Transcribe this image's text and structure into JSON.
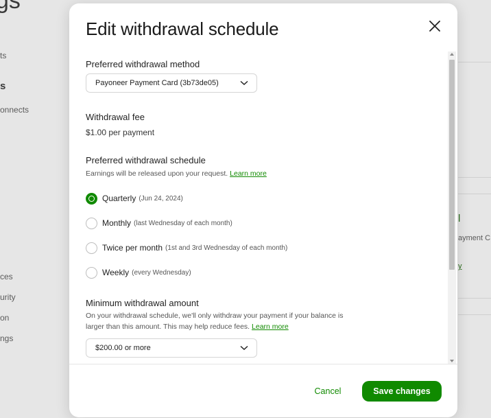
{
  "background": {
    "heading": "gs",
    "sidebar": [
      "ts",
      "s",
      "onnects",
      "ces",
      "urity",
      "on",
      "ngs"
    ],
    "right": [
      "l",
      "ayment C",
      "y"
    ]
  },
  "modal": {
    "title": "Edit withdrawal schedule",
    "method": {
      "label": "Preferred withdrawal method",
      "selected": "Payoneer Payment Card (3b73de05)"
    },
    "fee": {
      "label": "Withdrawal fee",
      "value": "$1.00 per payment"
    },
    "schedule": {
      "label": "Preferred withdrawal schedule",
      "description": "Earnings will be released upon your request.",
      "learn_more": "Learn more",
      "options": [
        {
          "label": "Quarterly",
          "note": "(Jun 24, 2024)",
          "checked": true
        },
        {
          "label": "Monthly",
          "note": "(last Wednesday of each month)",
          "checked": false
        },
        {
          "label": "Twice per month",
          "note": "(1st and 3rd Wednesday of each month)",
          "checked": false
        },
        {
          "label": "Weekly",
          "note": "(every Wednesday)",
          "checked": false
        }
      ]
    },
    "minimum": {
      "label": "Minimum withdrawal amount",
      "description": "On your withdrawal schedule, we'll only withdraw your payment if your balance is larger than this amount. This may help reduce fees.",
      "learn_more": "Learn more",
      "selected": "$200.00 or more"
    },
    "buttons": {
      "cancel": "Cancel",
      "save": "Save changes"
    }
  },
  "colors": {
    "accent": "#108a00",
    "overlay": "#e6e6e6"
  }
}
